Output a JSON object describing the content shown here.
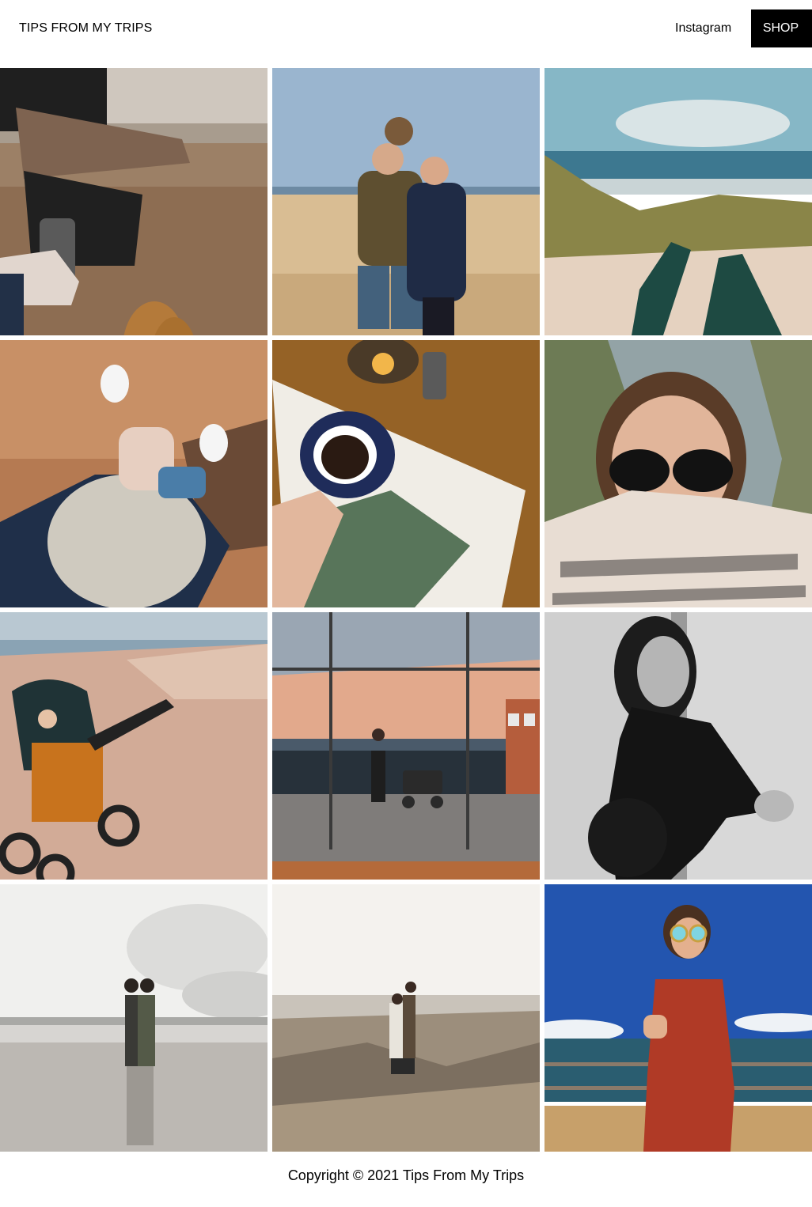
{
  "header": {
    "brand": "TIPS FROM MY TRIPS",
    "nav": {
      "instagram_label": "Instagram",
      "shop_label": "SHOP"
    }
  },
  "gallery": {
    "photos": [
      {
        "subject": "stroller-on-beach-photo"
      },
      {
        "subject": "family-on-beach-photo"
      },
      {
        "subject": "feet-in-dunes-photo"
      },
      {
        "subject": "baby-on-sand-photo"
      },
      {
        "subject": "coffee-and-book-photo"
      },
      {
        "subject": "sunglasses-selfie-photo"
      },
      {
        "subject": "stroller-at-sunset-photo"
      },
      {
        "subject": "mirror-promenade-photo"
      },
      {
        "subject": "pregnancy-portrait-photo"
      },
      {
        "subject": "couple-kissing-beach-photo"
      },
      {
        "subject": "couple-in-dunes-photo"
      },
      {
        "subject": "red-dress-seaside-photo"
      }
    ]
  },
  "footer": {
    "copyright": "Copyright © 2021 Tips From My Trips"
  },
  "colors": {
    "shop_bg": "#000000",
    "shop_text": "#ffffff",
    "page_bg": "#ffffff"
  }
}
